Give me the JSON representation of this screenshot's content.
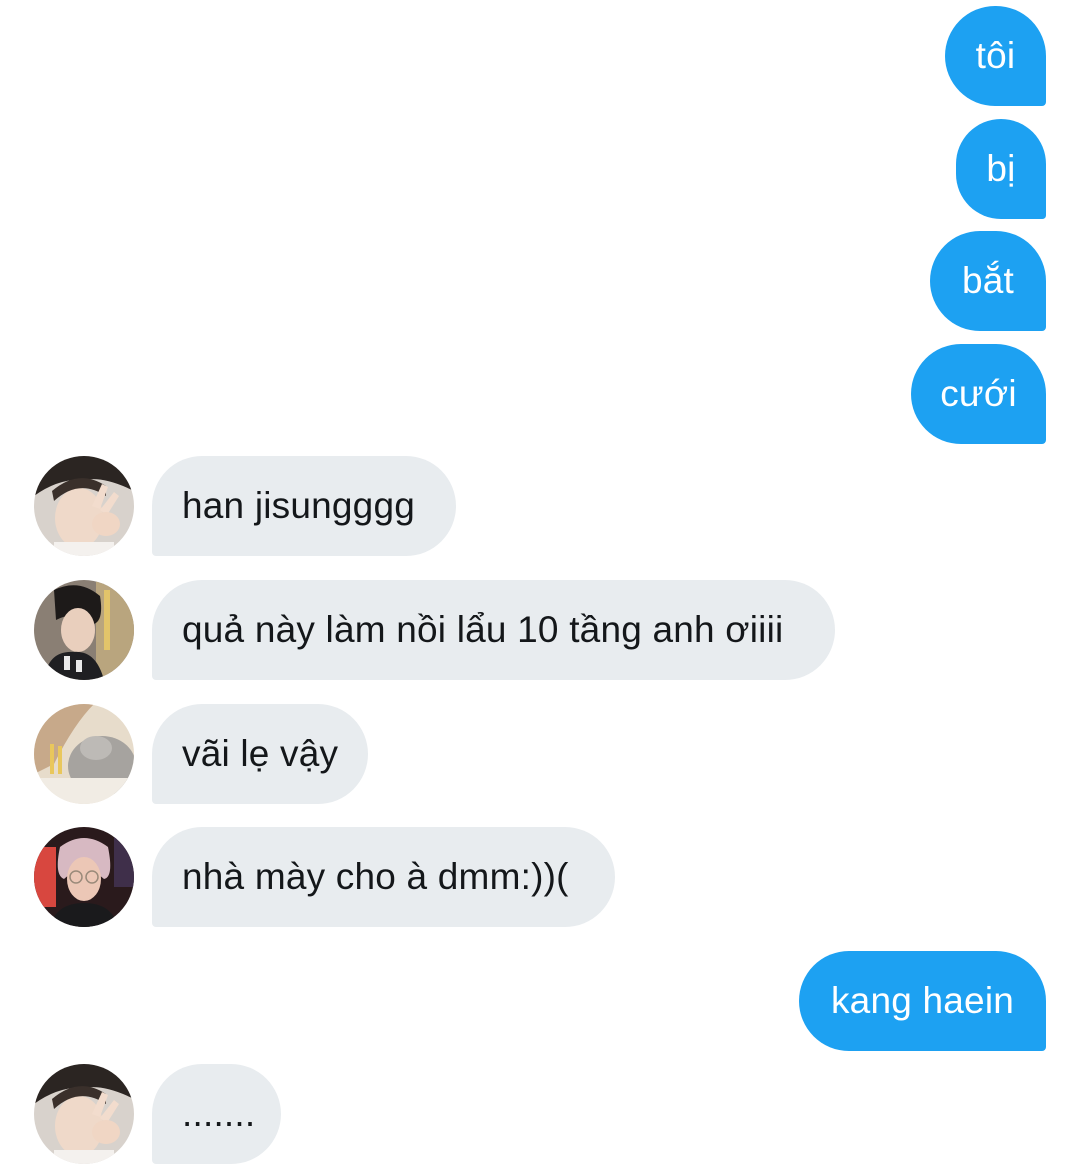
{
  "messages": [
    {
      "id": "m1",
      "direction": "outgoing",
      "text": "tôi"
    },
    {
      "id": "m2",
      "direction": "outgoing",
      "text": "bị"
    },
    {
      "id": "m3",
      "direction": "outgoing",
      "text": "bắt"
    },
    {
      "id": "m4",
      "direction": "outgoing",
      "text": "cưới"
    },
    {
      "id": "m5",
      "direction": "incoming",
      "text": "han jisungggg"
    },
    {
      "id": "m6",
      "direction": "incoming",
      "text": "quả này làm nồi lẩu 10 tầng anh ơiiii"
    },
    {
      "id": "m7",
      "direction": "incoming",
      "text": "vãi lẹ vậy"
    },
    {
      "id": "m8",
      "direction": "incoming",
      "text": "nhà mày cho à dmm:))("
    },
    {
      "id": "m9",
      "direction": "outgoing",
      "text": "kang haein"
    },
    {
      "id": "m10",
      "direction": "incoming",
      "text": "......."
    }
  ],
  "colors": {
    "outgoing_bubble": "#1da1f2",
    "incoming_bubble": "#e8ecef",
    "outgoing_text": "#ffffff",
    "incoming_text": "#14171a"
  }
}
